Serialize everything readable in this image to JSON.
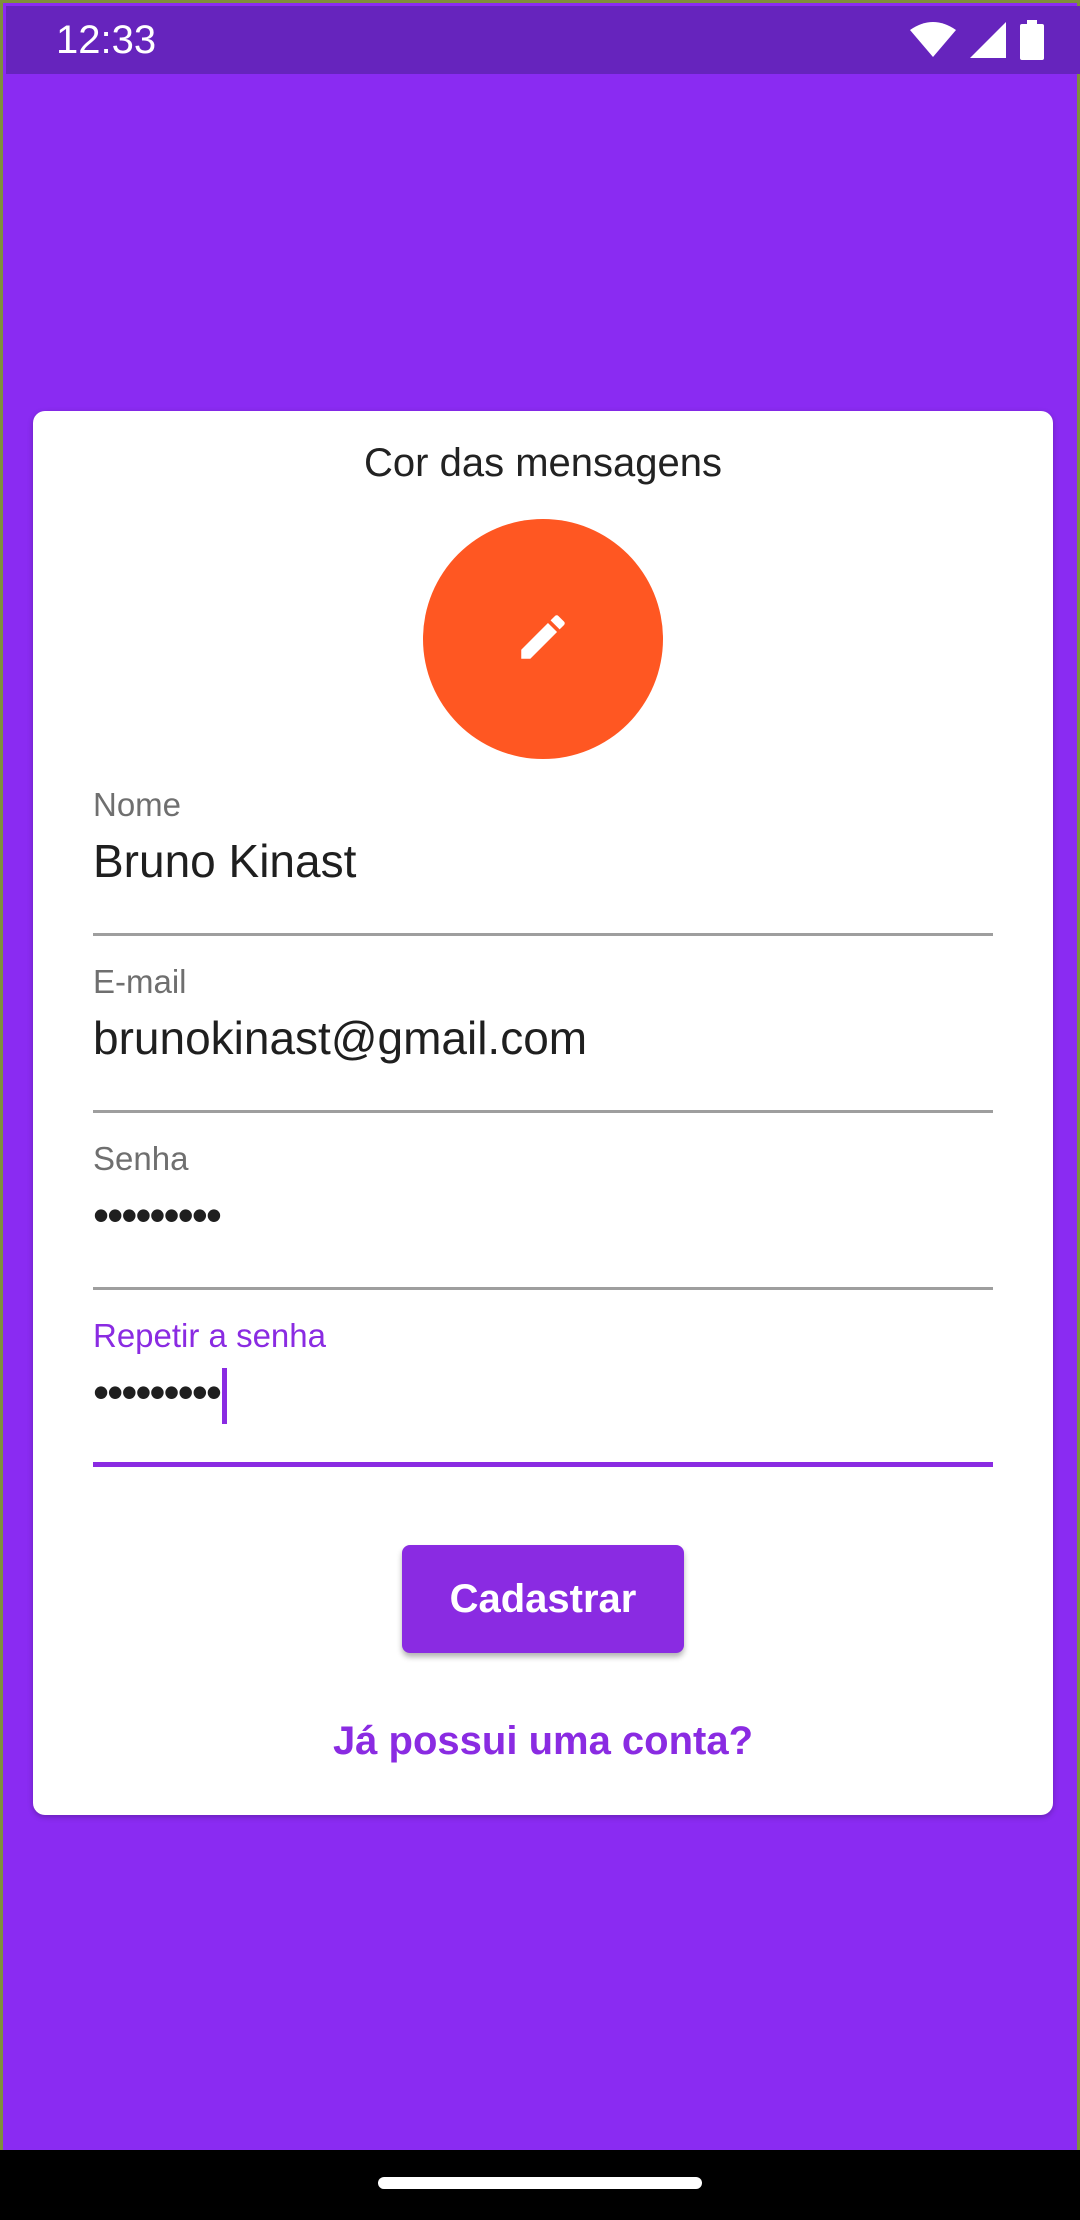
{
  "status_bar": {
    "time": "12:33",
    "icons": [
      "wifi-icon",
      "cellular-signal-icon",
      "battery-icon"
    ]
  },
  "card": {
    "title": "Cor das mensagens",
    "color_picker": {
      "color": "#FF5722",
      "icon": "pencil-icon"
    },
    "fields": {
      "name": {
        "label": "Nome",
        "value": "Bruno Kinast"
      },
      "email": {
        "label": "E-mail",
        "value": "brunokinast@gmail.com"
      },
      "password": {
        "label": "Senha",
        "value": "•••••••••"
      },
      "repeat_password": {
        "label": "Repetir a senha",
        "value": "•••••••••"
      }
    },
    "submit_label": "Cadastrar",
    "login_link_label": "Já possui uma conta?"
  },
  "colors": {
    "background": "#8A2BF2",
    "status_bar": "#6624BD",
    "accent": "#8A2BE2",
    "picker": "#FF5722"
  }
}
